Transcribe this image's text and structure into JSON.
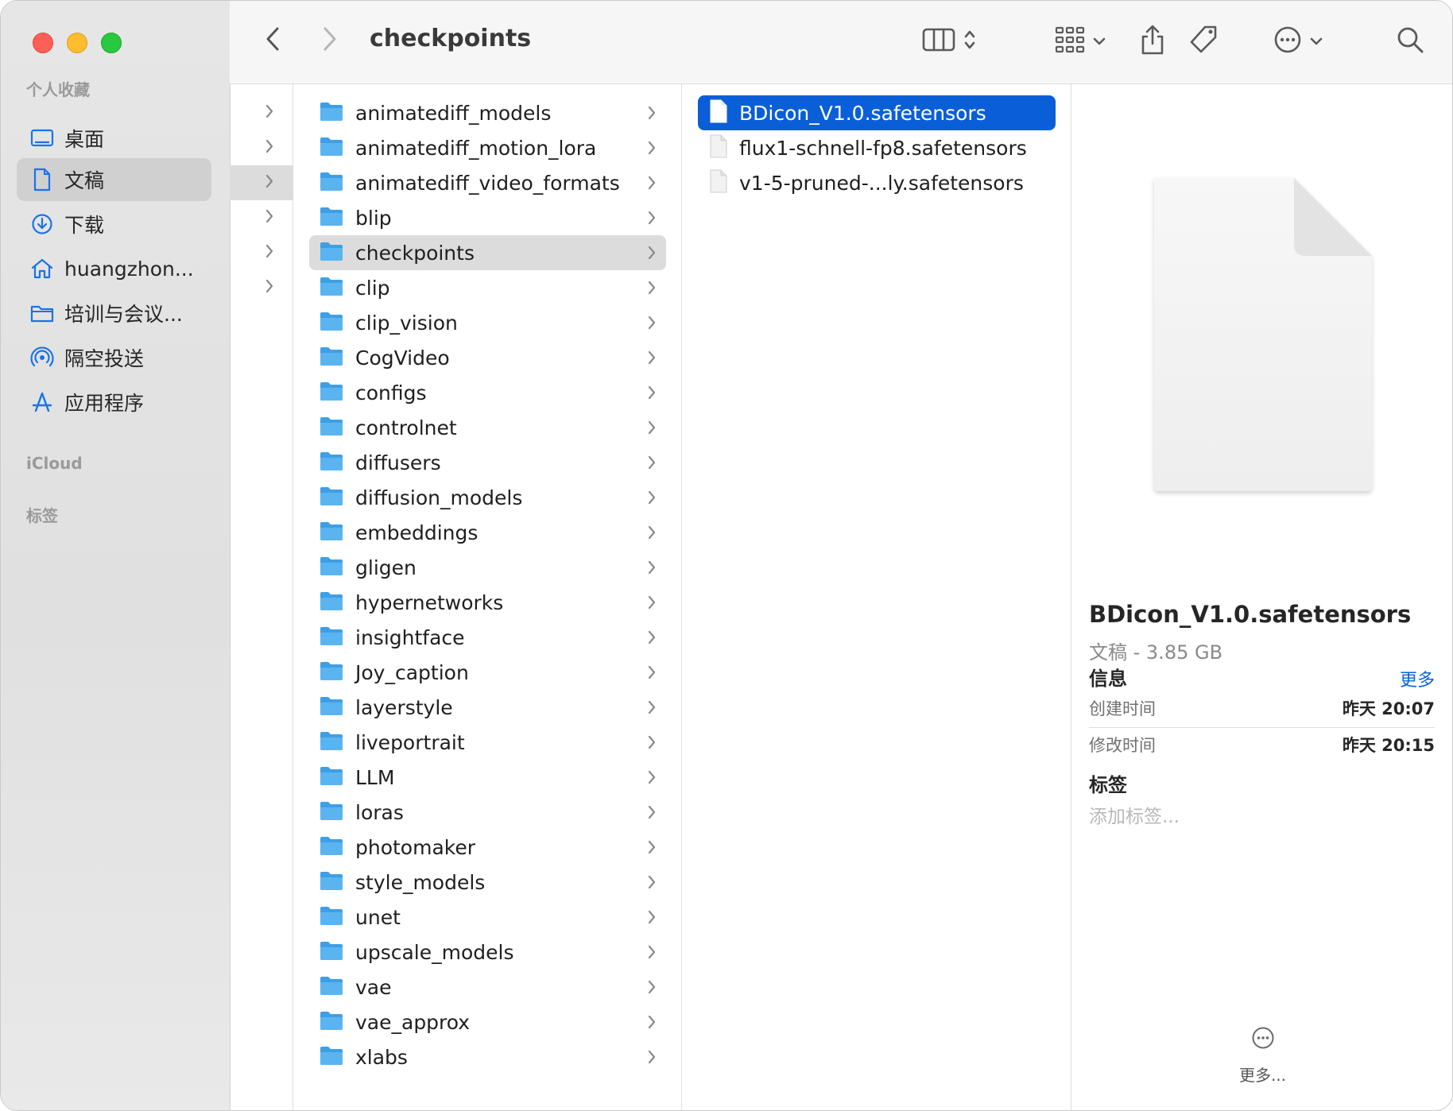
{
  "toolbar": {
    "title": "checkpoints"
  },
  "sidebar": {
    "favorites_header": "个人收藏",
    "items": [
      {
        "label": "桌面",
        "icon": "desktop-icon"
      },
      {
        "label": "文稿",
        "icon": "document-icon"
      },
      {
        "label": "下载",
        "icon": "download-icon"
      },
      {
        "label": "huangzhon...",
        "icon": "home-icon"
      },
      {
        "label": "培训与会议...",
        "icon": "folder-icon"
      },
      {
        "label": "隔空投送",
        "icon": "airdrop-icon"
      },
      {
        "label": "应用程序",
        "icon": "applications-icon"
      }
    ],
    "icloud_header": "iCloud",
    "tags_header": "标签"
  },
  "folders": [
    "animatediff_models",
    "animatediff_motion_lora",
    "animatediff_video_formats",
    "blip",
    "checkpoints",
    "clip",
    "clip_vision",
    "CogVideo",
    "configs",
    "controlnet",
    "diffusers",
    "diffusion_models",
    "embeddings",
    "gligen",
    "hypernetworks",
    "insightface",
    "Joy_caption",
    "layerstyle",
    "liveportrait",
    "LLM",
    "loras",
    "photomaker",
    "style_models",
    "unet",
    "upscale_models",
    "vae",
    "vae_approx",
    "xlabs"
  ],
  "files": [
    "BDicon_V1.0.safetensors",
    "flux1-schnell-fp8.safetensors",
    "v1-5-pruned-...ly.safetensors"
  ],
  "preview": {
    "name": "BDicon_V1.0.safetensors",
    "kind_size": "文稿 - 3.85 GB",
    "info_header": "信息",
    "more_link": "更多",
    "created_label": "创建时间",
    "created_value": "昨天 20:07",
    "modified_label": "修改时间",
    "modified_value": "昨天 20:15",
    "tags_header": "标签",
    "tags_placeholder": "添加标签...",
    "more_button": "更多..."
  },
  "colors": {
    "accent": "#0a5fd8",
    "folder": "#5ab4f0"
  }
}
